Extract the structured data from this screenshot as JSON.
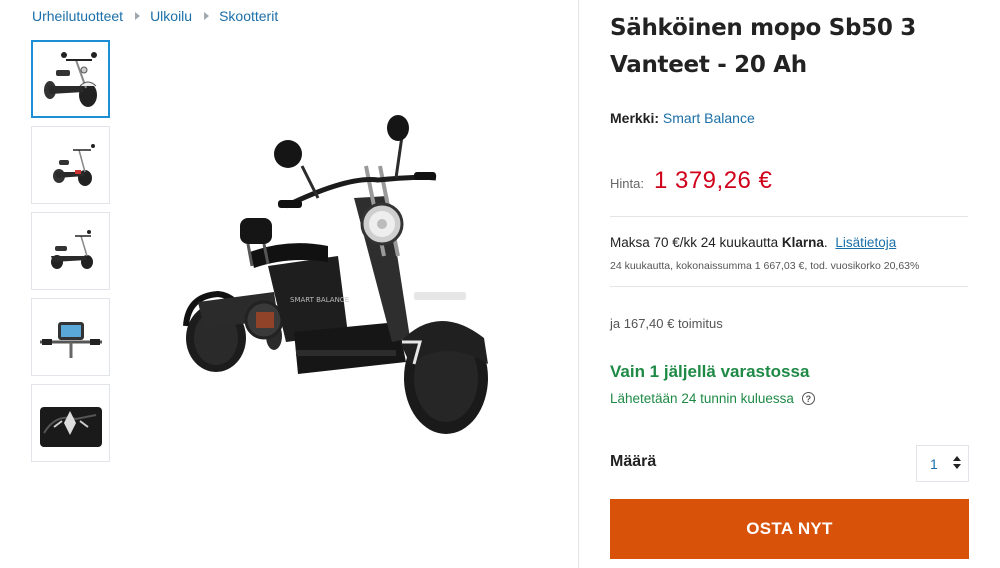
{
  "breadcrumb": {
    "items": [
      "Urheilutuotteet",
      "Ulkoilu",
      "Skootterit"
    ]
  },
  "gallery": {
    "thumbnail_count": 5,
    "selected_index": 0
  },
  "product": {
    "title": "Sähköinen mopo Sb50 3 Vanteet - 20 Ah",
    "brand_label": "Merkki:",
    "brand_value": "Smart Balance",
    "price_label": "Hinta:",
    "price": "1 379,26 €",
    "klarna_text_pre": "Maksa 70 €/kk 24 kuukautta ",
    "klarna_brand": "Klarna",
    "klarna_dot": ".",
    "klarna_link": "Lisätietoja",
    "klarna_sub": "24 kuukautta, kokonaissumma 1 667,03 €, tod. vuosikorko 20,63%",
    "shipping": "ja 167,40 € toimitus",
    "stock": "Vain 1 jäljellä varastossa",
    "ships_info": "Lähetetään 24 tunnin kuluessa",
    "help_glyph": "?",
    "quantity_label": "Määrä",
    "quantity_value": "1",
    "buy_label": "OSTA NYT"
  },
  "colors": {
    "link": "#1b6fa8",
    "price": "#d0021b",
    "stock": "#1f8a46",
    "buy_button": "#d9520a",
    "thumb_active_border": "#1b8ed4"
  }
}
